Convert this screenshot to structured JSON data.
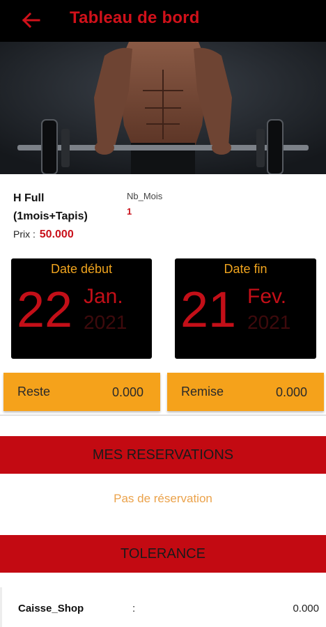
{
  "appbar": {
    "title": "Tableau de bord",
    "back_icon": "arrow-left-icon",
    "title_color": "#d0111a"
  },
  "hero": {
    "image": "bodybuilder-barbell-photo"
  },
  "plan": {
    "name": "H Full (1mois+Tapis)",
    "price_label": "Prix :",
    "price_value": "50.000",
    "nb_mois_label": "Nb_Mois",
    "nb_mois_value": "1"
  },
  "dates": {
    "start": {
      "label": "Date début",
      "day": "22",
      "month": "Jan.",
      "year": "2021"
    },
    "end": {
      "label": "Date fin",
      "day": "21",
      "month": "Fev.",
      "year": "2021"
    }
  },
  "balance": {
    "reste_label": "Reste",
    "reste_value": "0.000",
    "remise_label": "Remise",
    "remise_value": "0.000"
  },
  "reservations": {
    "title": "MES RESERVATIONS",
    "empty_message": "Pas de réservation"
  },
  "tolerance": {
    "title": "TOLERANCE",
    "caisse_label": "Caisse_Shop",
    "separator": ":",
    "caisse_value": "0.000"
  },
  "colors": {
    "accent_red": "#c30a12",
    "orange": "#f5a21b",
    "label_orange": "#f0a41e"
  }
}
